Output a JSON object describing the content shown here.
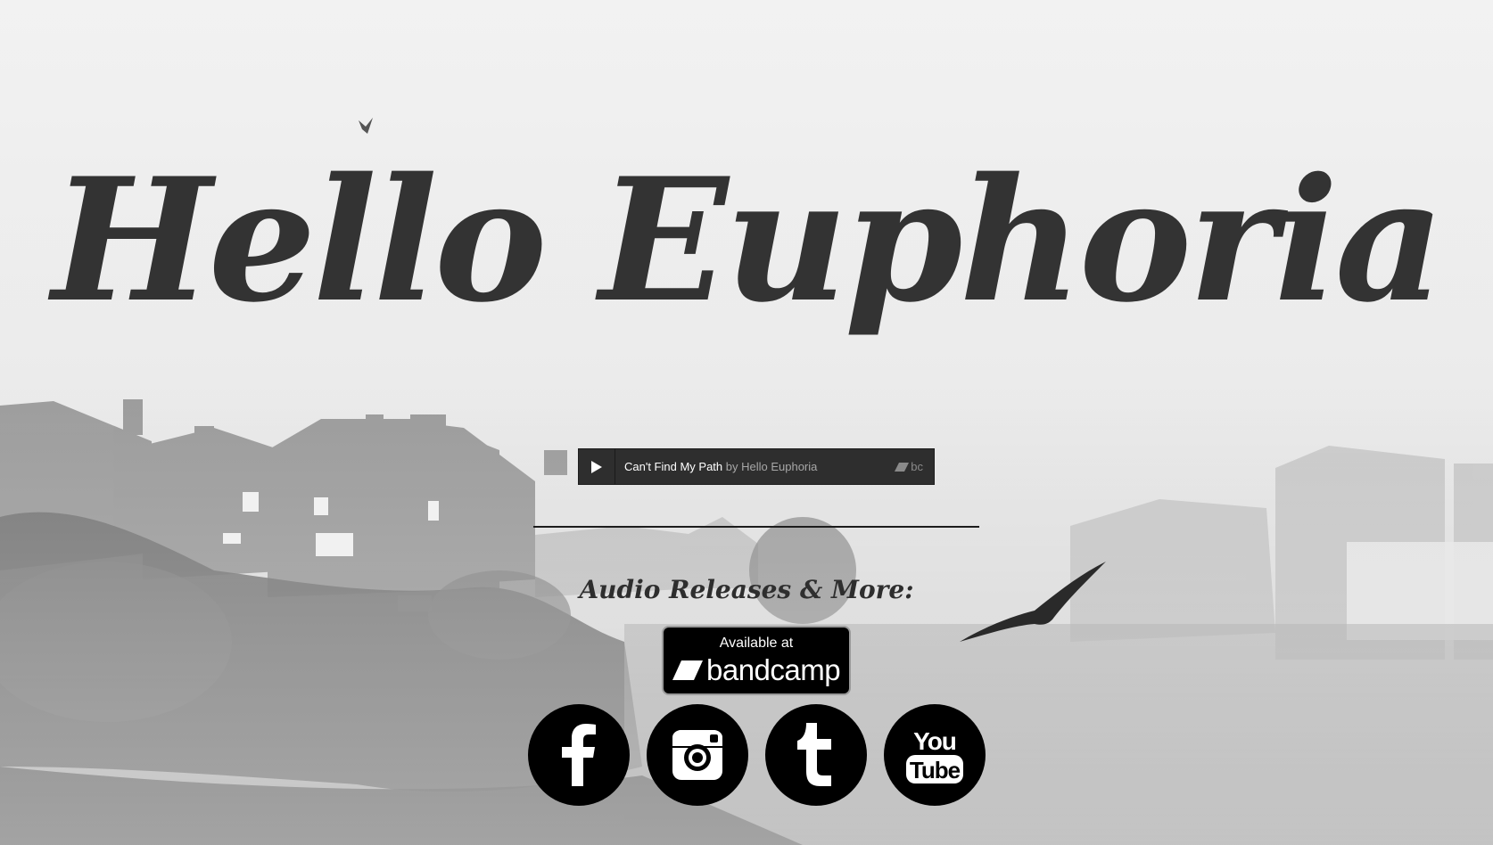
{
  "site": {
    "title": "Hello Euphoria"
  },
  "player": {
    "track_title": "Can't Find My Path",
    "by_artist": "by Hello Euphoria",
    "logo_text": "bc",
    "play_icon": "play-icon"
  },
  "releases": {
    "heading": "Audio Releases & More:",
    "badge_line1": "Available at",
    "badge_line2": "bandcamp"
  },
  "social": {
    "items": [
      {
        "name": "facebook",
        "icon": "facebook-icon",
        "glyph": "f"
      },
      {
        "name": "instagram",
        "icon": "instagram-icon"
      },
      {
        "name": "tumblr",
        "icon": "tumblr-icon",
        "glyph": "t"
      },
      {
        "name": "youtube",
        "icon": "youtube-icon",
        "line1": "You",
        "line2": "Tube"
      }
    ]
  },
  "colors": {
    "title": "#333333",
    "player_bg": "#2e2e2e",
    "player_artist": "#a7a7a7",
    "icon_bg": "#000000",
    "background_fog": "#efefef"
  }
}
